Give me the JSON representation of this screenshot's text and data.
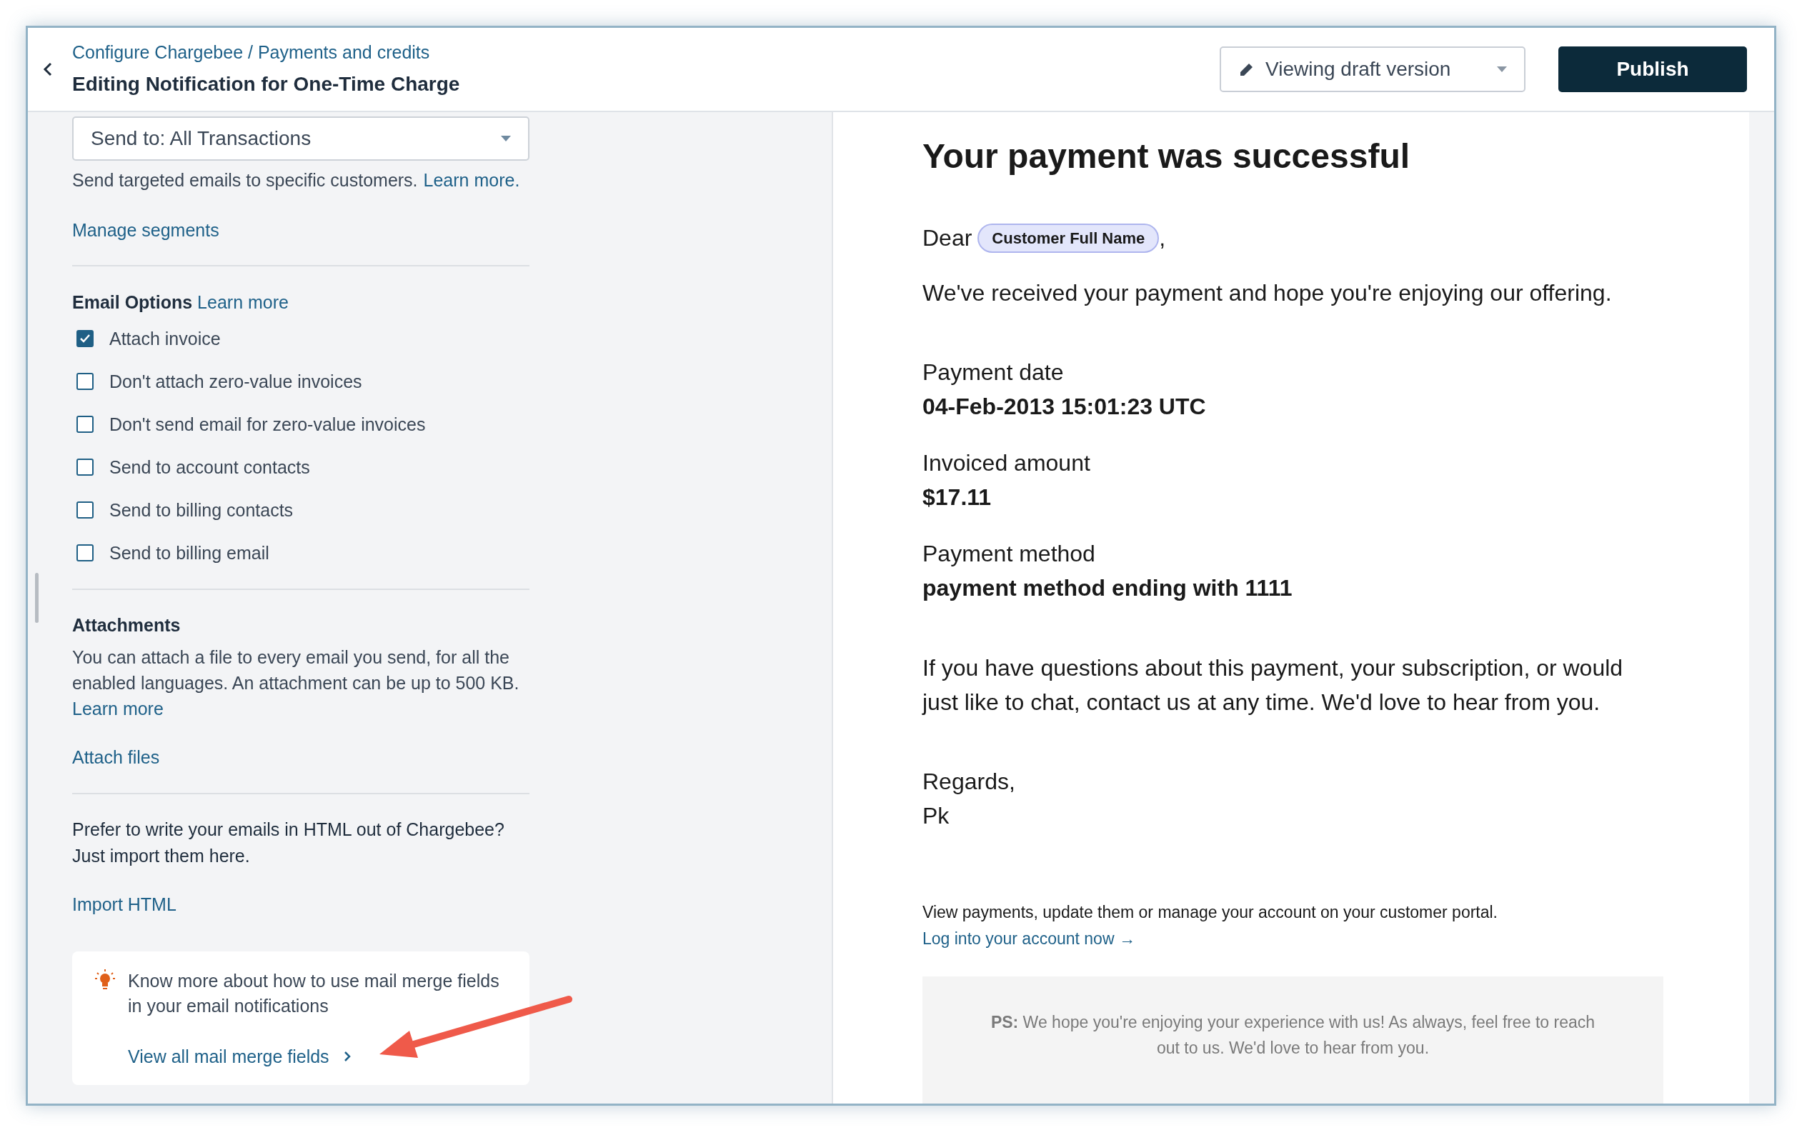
{
  "header": {
    "breadcrumb": "Configure Chargebee / Payments and credits",
    "title": "Editing Notification for One-Time Charge",
    "version_dropdown": "Viewing draft version",
    "publish_button": "Publish"
  },
  "settings": {
    "send_to": "Send to: All Transactions",
    "targeting_text": "Send targeted emails to specific customers.",
    "targeting_link": "Learn more.",
    "manage_segments": "Manage segments",
    "email_options": {
      "title": "Email Options",
      "link": "Learn more",
      "options": [
        {
          "label": "Attach invoice",
          "checked": true
        },
        {
          "label": "Don't attach zero-value invoices",
          "checked": false
        },
        {
          "label": "Don't send email for zero-value invoices",
          "checked": false
        },
        {
          "label": "Send to account contacts",
          "checked": false
        },
        {
          "label": "Send to billing contacts",
          "checked": false
        },
        {
          "label": "Send to billing email",
          "checked": false
        }
      ]
    },
    "attachments": {
      "title": "Attachments",
      "description": "You can attach a file to every email you send, for all the enabled languages. An attachment can be up to 500 KB.",
      "learn_more": "Learn more",
      "attach_files": "Attach files"
    },
    "import": {
      "text": "Prefer to write your emails in HTML out of Chargebee? Just import them here.",
      "link": "Import HTML"
    },
    "tip": {
      "text": "Know more about how to use mail merge fields in your email notifications",
      "link": "View all mail merge fields"
    }
  },
  "email": {
    "heading": "Your payment was successful",
    "greeting": "Dear",
    "merge_field": "Customer Full Name",
    "greeting_end": ",",
    "intro": "We've received your payment and hope you're enjoying our offering.",
    "fields": [
      {
        "label": "Payment date",
        "value": "04-Feb-2013 15:01:23 UTC"
      },
      {
        "label": "Invoiced amount",
        "value": "$17.11"
      },
      {
        "label": "Payment method",
        "value": "payment method ending with 1111"
      }
    ],
    "questions": "If you have questions about this payment, your subscription, or would just like to chat, contact us at any time. We'd love to hear from you.",
    "sign_off": "Regards,",
    "signature": "Pk",
    "portal_text": "View payments, update them or manage your account on your customer portal.",
    "portal_link": "Log into your account now →",
    "ps": "**PS:** We hope you're enjoying your experience with us! As always, feel free to reach out to us. We'd love to hear from you."
  }
}
